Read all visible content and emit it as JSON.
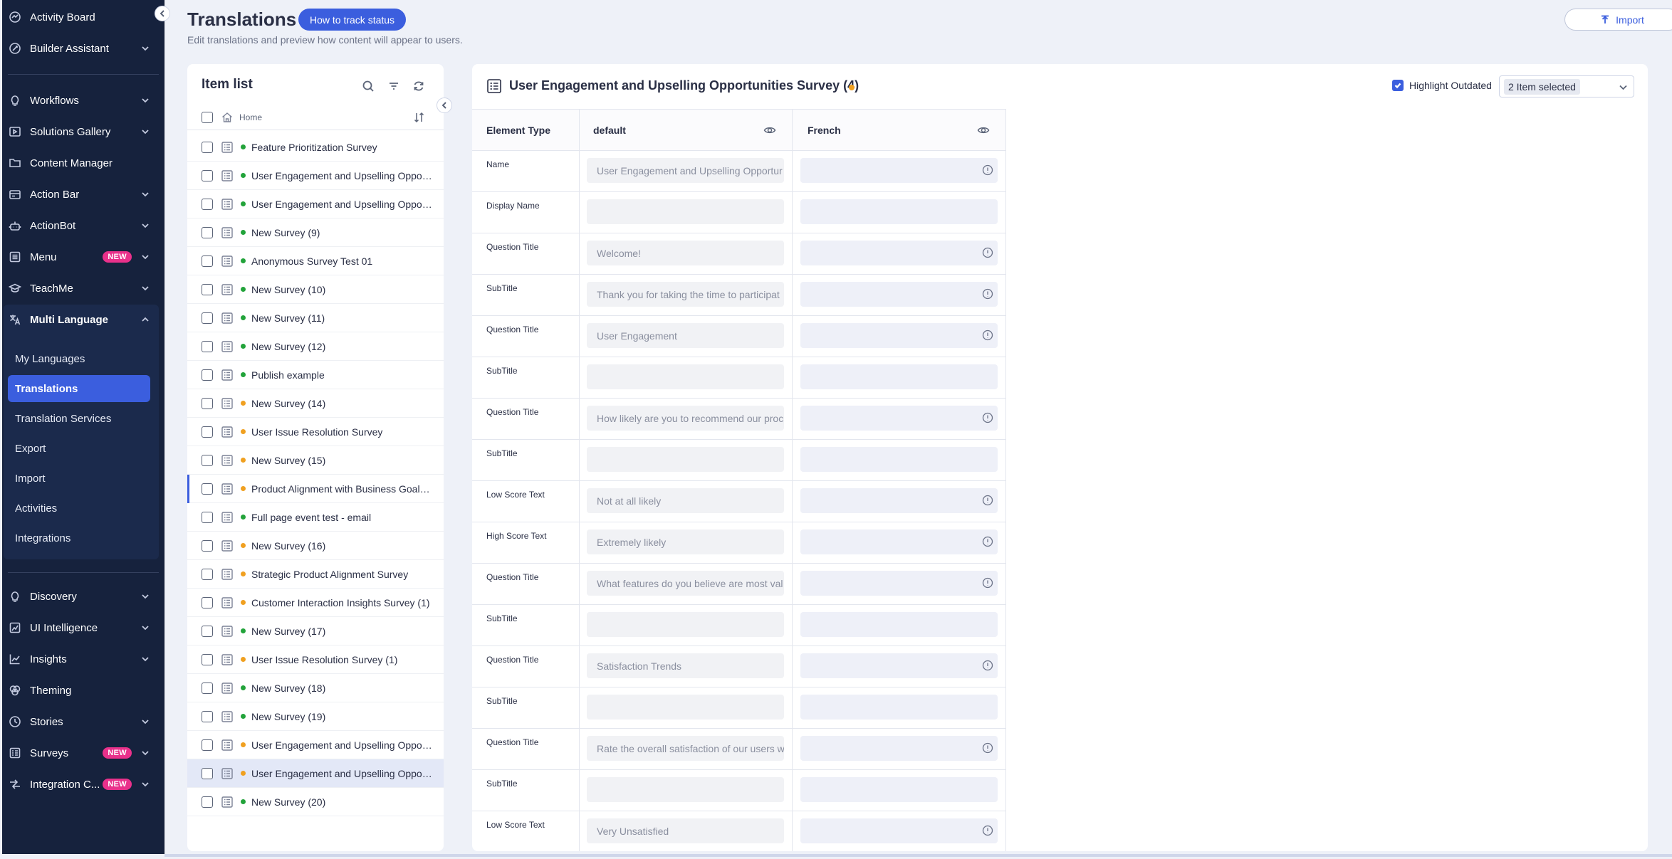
{
  "sidebar": {
    "top_items": [
      {
        "label": "Activity Board",
        "icon": "activity-icon",
        "chevron": false
      },
      {
        "label": "Builder Assistant",
        "icon": "assistant-icon",
        "chevron": true
      }
    ],
    "items": [
      {
        "label": "Workflows",
        "icon": "bulb-icon",
        "chevron": true
      },
      {
        "label": "Solutions Gallery",
        "icon": "gallery-icon",
        "chevron": true
      },
      {
        "label": "Content Manager",
        "icon": "folder-icon",
        "chevron": false
      },
      {
        "label": "Action Bar",
        "icon": "action-bar-icon",
        "chevron": true
      },
      {
        "label": "ActionBot",
        "icon": "bot-icon",
        "chevron": true
      },
      {
        "label": "Menu",
        "icon": "menu-icon",
        "chevron": true,
        "badge": "NEW"
      },
      {
        "label": "TeachMe",
        "icon": "teachme-icon",
        "chevron": true
      }
    ],
    "multi_language": {
      "label": "Multi Language",
      "icon": "translate-icon",
      "sub_items": [
        "My Languages",
        "Translations",
        "Translation Services",
        "Export",
        "Import",
        "Activities",
        "Integrations"
      ],
      "active": "Translations"
    },
    "bottom_items": [
      {
        "label": "Discovery",
        "icon": "discovery-icon",
        "chevron": true
      },
      {
        "label": "UI Intelligence",
        "icon": "ui-intel-icon",
        "chevron": true
      },
      {
        "label": "Insights",
        "icon": "insights-icon",
        "chevron": true
      },
      {
        "label": "Theming",
        "icon": "theming-icon",
        "chevron": false
      },
      {
        "label": "Stories",
        "icon": "stories-icon",
        "chevron": true
      },
      {
        "label": "Surveys",
        "icon": "surveys-icon",
        "chevron": true,
        "badge": "NEW"
      },
      {
        "label": "Integration C...",
        "icon": "integration-icon",
        "chevron": true,
        "badge": "NEW"
      }
    ]
  },
  "header": {
    "title": "Translations",
    "track_button": "How to track status",
    "subtitle": "Edit translations and preview how content will appear to users.",
    "import_button": "Import"
  },
  "item_list": {
    "title": "Item list",
    "breadcrumb": "Home",
    "items": [
      {
        "label": "Feature Prioritization Survey",
        "status": "green"
      },
      {
        "label": "User Engagement and Upselling Oppor...",
        "status": "green"
      },
      {
        "label": "User Engagement and Upselling Oppor...",
        "status": "green"
      },
      {
        "label": "New Survey (9)",
        "status": "green"
      },
      {
        "label": "Anonymous Survey Test 01",
        "status": "green"
      },
      {
        "label": "New Survey (10)",
        "status": "green"
      },
      {
        "label": "New Survey (11)",
        "status": "green"
      },
      {
        "label": "New Survey (12)",
        "status": "green"
      },
      {
        "label": "Publish example",
        "status": "green"
      },
      {
        "label": "New Survey (14)",
        "status": "orange"
      },
      {
        "label": "User Issue Resolution Survey",
        "status": "orange"
      },
      {
        "label": "New Survey (15)",
        "status": "orange"
      },
      {
        "label": "Product Alignment with Business Goals ...",
        "status": "orange",
        "marker": true
      },
      {
        "label": "Full page event test - email",
        "status": "green"
      },
      {
        "label": "New Survey (16)",
        "status": "orange"
      },
      {
        "label": "Strategic Product Alignment Survey",
        "status": "orange"
      },
      {
        "label": "Customer Interaction Insights Survey (1)",
        "status": "orange"
      },
      {
        "label": "New Survey (17)",
        "status": "green"
      },
      {
        "label": "User Issue Resolution Survey (1)",
        "status": "orange"
      },
      {
        "label": "New Survey (18)",
        "status": "green"
      },
      {
        "label": "New Survey (19)",
        "status": "green"
      },
      {
        "label": "User Engagement and Upselling Oppor...",
        "status": "orange"
      },
      {
        "label": "User Engagement and Upselling Oppor...",
        "status": "orange",
        "selected": true
      },
      {
        "label": "New Survey (20)",
        "status": "green"
      }
    ]
  },
  "detail": {
    "title": "User Engagement and Upselling Opportunities Survey (4)",
    "highlight_label": "Highlight Outdated",
    "highlight_checked": true,
    "selected_tag": "2 Item selected",
    "columns": {
      "type": "Element Type",
      "default": "default",
      "french": "French"
    },
    "rows": [
      {
        "type": "Name",
        "default": "User Engagement and Upselling Opportur",
        "info": true
      },
      {
        "type": "Display Name",
        "default": "",
        "info": false
      },
      {
        "type": "Question Title",
        "default": "Welcome!",
        "info": true
      },
      {
        "type": "SubTitle",
        "default": "Thank you for taking the time to participat",
        "info": true
      },
      {
        "type": "Question Title",
        "default": "User Engagement",
        "info": true
      },
      {
        "type": "SubTitle",
        "default": "",
        "info": false
      },
      {
        "type": "Question Title",
        "default": "How likely are you to recommend our proc",
        "info": true
      },
      {
        "type": "SubTitle",
        "default": "",
        "info": false
      },
      {
        "type": "Low Score Text",
        "default": "Not at all likely",
        "info": true
      },
      {
        "type": "High Score Text",
        "default": "Extremely likely",
        "info": true
      },
      {
        "type": "Question Title",
        "default": "What features do you believe are most val",
        "info": true
      },
      {
        "type": "SubTitle",
        "default": "",
        "info": false
      },
      {
        "type": "Question Title",
        "default": "Satisfaction Trends",
        "info": true
      },
      {
        "type": "SubTitle",
        "default": "",
        "info": false
      },
      {
        "type": "Question Title",
        "default": "Rate the overall satisfaction of our users w",
        "info": true
      },
      {
        "type": "SubTitle",
        "default": "",
        "info": false
      },
      {
        "type": "Low Score Text",
        "default": "Very Unsatisfied",
        "info": true
      }
    ]
  },
  "colors": {
    "accent": "#3b5ede",
    "sidebar": "#16223d",
    "badge": "#e9318b",
    "green": "#22a33a",
    "orange": "#f0a020"
  }
}
